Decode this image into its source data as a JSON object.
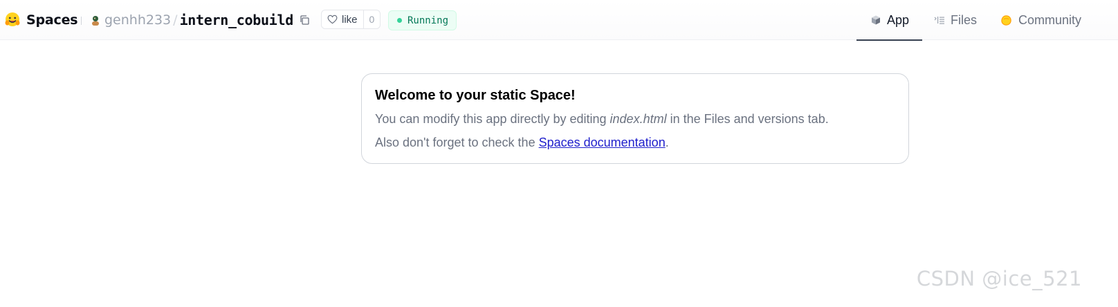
{
  "header": {
    "brand": "Spaces",
    "repo": {
      "owner": "genhh233",
      "separator": "/",
      "name": "intern_cobuild"
    },
    "like": {
      "label": "like",
      "count": "0"
    },
    "status": {
      "label": "Running",
      "color": "#34d399"
    },
    "tabs": [
      {
        "label": "App",
        "icon": "cube-icon",
        "active": true
      },
      {
        "label": "Files",
        "icon": "files-list-icon",
        "active": false
      },
      {
        "label": "Community",
        "icon": "community-hand-icon",
        "active": false
      }
    ]
  },
  "card": {
    "title": "Welcome to your static Space!",
    "line1_before": "You can modify this app directly by editing ",
    "line1_file": "index.html",
    "line1_after": " in the Files and versions tab.",
    "line2_before": "Also don't forget to check the ",
    "line2_link": "Spaces documentation",
    "line2_after": "."
  },
  "watermark": "CSDN @ice_521",
  "colors": {
    "brand_yellow": "#FFD21E",
    "status_bg": "#ecfdf5",
    "status_text": "#047857",
    "link": "#2020cc"
  }
}
